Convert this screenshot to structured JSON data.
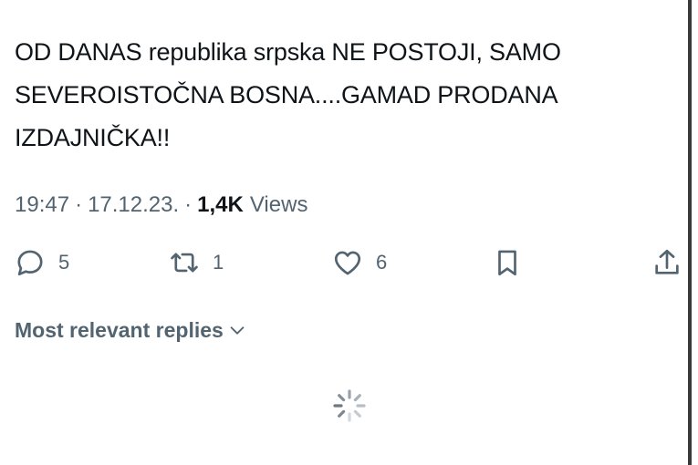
{
  "post": {
    "text": "OD DANAS republika srpska NE POSTOJI, SAMO\nSEVEROISTOČNA BOSNA....GAMAD PRODANA\nIZDAJNIČKA!!",
    "time": "19:47",
    "date": "17.12.23.",
    "separator": "·",
    "views_count": "1,4K",
    "views_label": "Views"
  },
  "actions": {
    "reply_count": "5",
    "repost_count": "1",
    "like_count": "6"
  },
  "replies": {
    "sort_label": "Most relevant replies"
  },
  "icons": [
    "reply-icon",
    "repost-icon",
    "like-icon",
    "bookmark-icon",
    "share-icon",
    "chevron-down-icon",
    "loading-spinner"
  ],
  "colors": {
    "text": "#0f1419",
    "secondary": "#536471"
  }
}
